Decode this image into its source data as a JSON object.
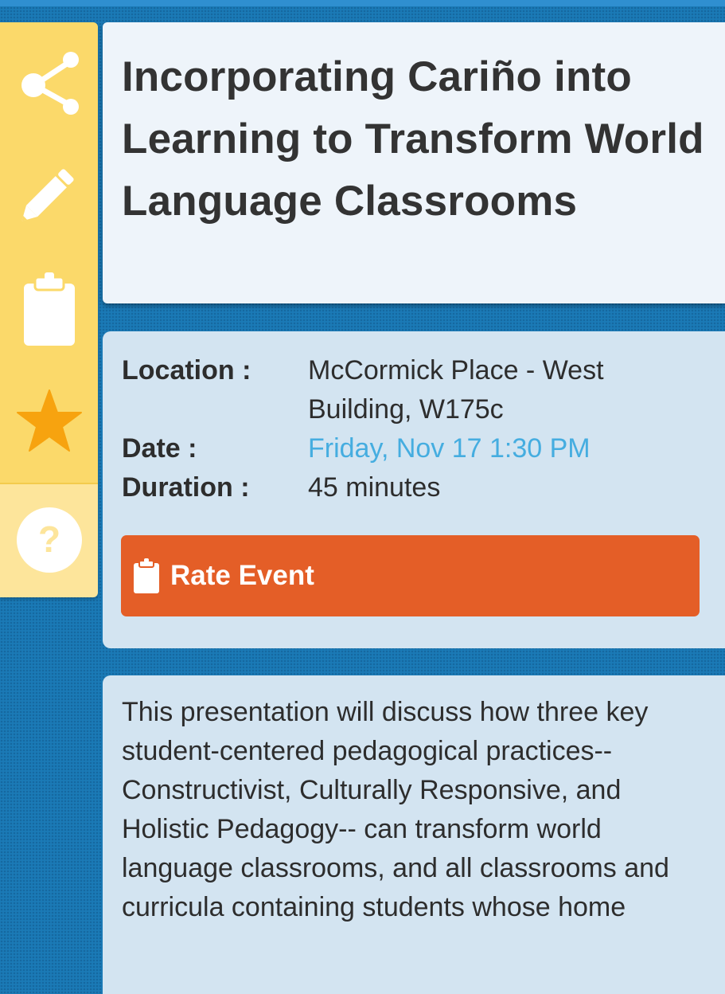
{
  "session": {
    "title": "Incorporating Cariño into Learning to Transform World Language Classrooms"
  },
  "details": {
    "location_label": "Location :",
    "location_value": "McCormick Place - West Building, W175c",
    "date_label": "Date :",
    "date_value": "Friday, Nov 17 1:30 PM",
    "duration_label": "Duration :",
    "duration_value": "45 minutes"
  },
  "actions": {
    "rate_label": "Rate Event"
  },
  "description": {
    "text": "This presentation will discuss how three key student-centered pedagogical practices-- Constructivist, Culturally Responsive, and Holistic Pedagogy-- can transform world language classrooms, and all classrooms and curricula containing students whose home"
  },
  "sidebar": {
    "items": [
      {
        "icon": "share-icon"
      },
      {
        "icon": "pencil-icon"
      },
      {
        "icon": "clipboard-icon"
      },
      {
        "icon": "star-icon"
      },
      {
        "icon": "help-icon"
      }
    ]
  },
  "colors": {
    "background": "#1b7ab6",
    "sidebar": "#fbd96a",
    "sidebar_help": "#fde59b",
    "star": "#f7a30f",
    "card": "#d3e4f1",
    "title_card": "#eef4fa",
    "link": "#45ade0",
    "rate_button": "#e45e27"
  }
}
